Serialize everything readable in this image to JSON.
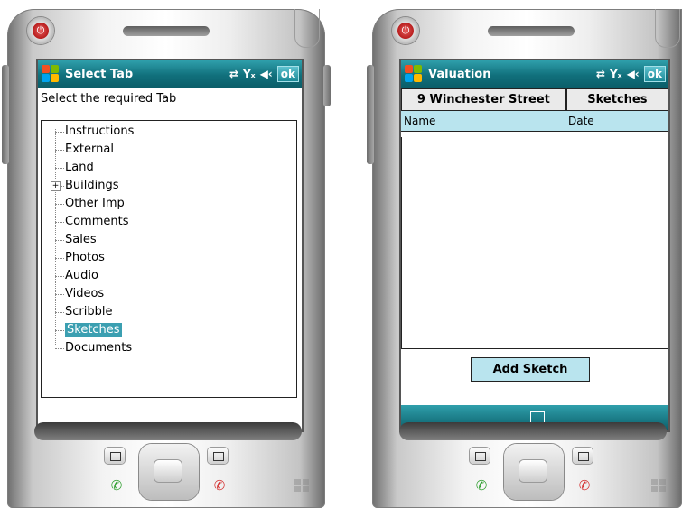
{
  "left_screen": {
    "title": "Select Tab",
    "ok_label": "ok",
    "prompt": "Select the required Tab",
    "tree_items": [
      {
        "label": "Instructions",
        "expandable": false,
        "selected": false
      },
      {
        "label": "External",
        "expandable": false,
        "selected": false
      },
      {
        "label": "Land",
        "expandable": false,
        "selected": false
      },
      {
        "label": "Buildings",
        "expandable": true,
        "selected": false
      },
      {
        "label": "Other Imp",
        "expandable": false,
        "selected": false
      },
      {
        "label": "Comments",
        "expandable": false,
        "selected": false
      },
      {
        "label": "Sales",
        "expandable": false,
        "selected": false
      },
      {
        "label": "Photos",
        "expandable": false,
        "selected": false
      },
      {
        "label": "Audio",
        "expandable": false,
        "selected": false
      },
      {
        "label": "Videos",
        "expandable": false,
        "selected": false
      },
      {
        "label": "Scribble",
        "expandable": false,
        "selected": false
      },
      {
        "label": "Sketches",
        "expandable": false,
        "selected": true
      },
      {
        "label": "Documents",
        "expandable": false,
        "selected": false
      }
    ],
    "expand_glyph": "+"
  },
  "right_screen": {
    "title": "Valuation",
    "ok_label": "ok",
    "address_button": "9 Winchester Street",
    "tab_button": "Sketches",
    "columns": [
      "Name",
      "Date"
    ],
    "rows": [],
    "add_button": "Add Sketch"
  },
  "status_icons": [
    "connectivity-icon",
    "signal-off-icon",
    "volume-icon"
  ],
  "colors": {
    "titlebar": "#11707c",
    "selection": "#3b9fb1",
    "header_fill": "#b9e4ee"
  }
}
